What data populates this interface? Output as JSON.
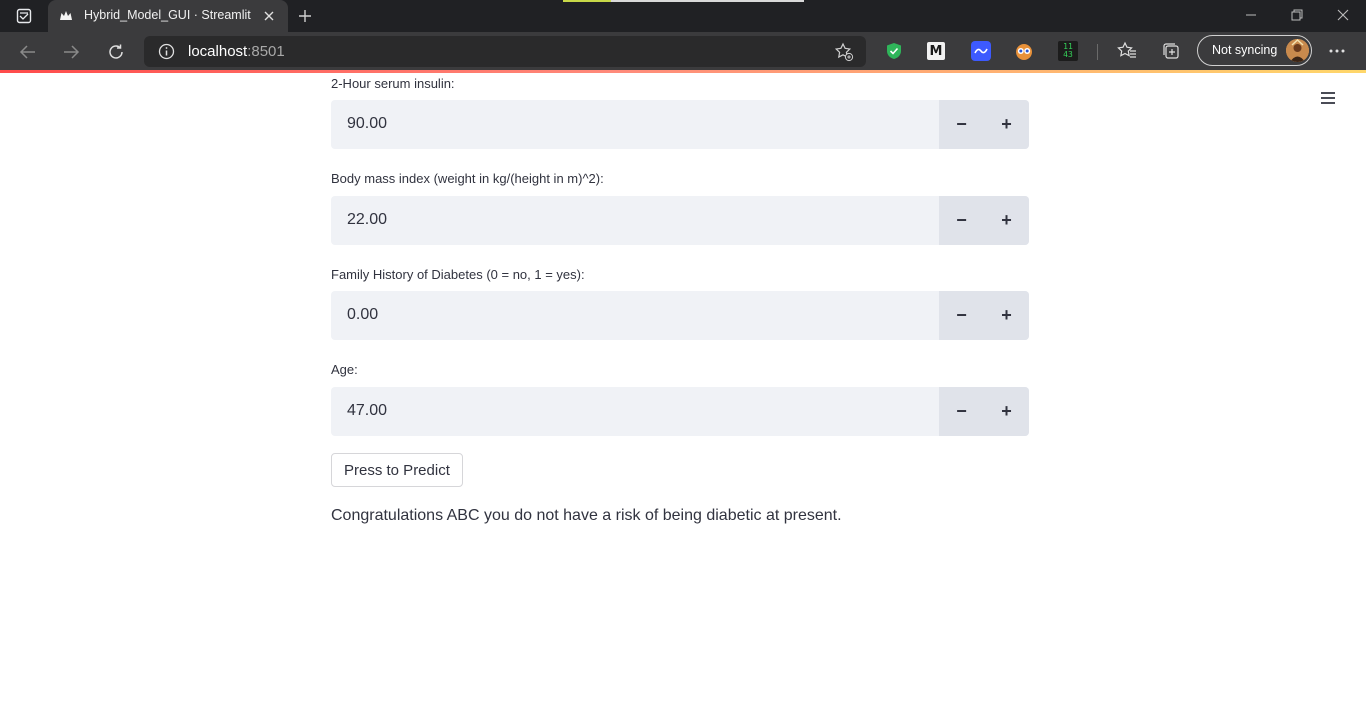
{
  "browser": {
    "tab_title": "Hybrid_Model_GUI · Streamlit",
    "url_host": "localhost",
    "url_port": ":8501",
    "sync_label": "Not syncing",
    "extension_badge": "11\n43",
    "icons": {
      "tab_actions": "tab-actions-icon",
      "favicon": "streamlit-crown-icon",
      "close": "close-icon",
      "new_tab": "plus-icon",
      "back": "back-arrow-icon",
      "forward": "forward-arrow-icon",
      "refresh": "refresh-icon",
      "info": "info-icon",
      "favorites_add": "star-plus-icon",
      "more": "ellipsis-icon"
    }
  },
  "app": {
    "menu_icon": "hamburger-menu-icon",
    "fields": [
      {
        "label": "2-Hour serum insulin:",
        "value": "90.00"
      },
      {
        "label": "Body mass index (weight in kg/(height in m)^2):",
        "value": "22.00"
      },
      {
        "label": "Family History of Diabetes (0 = no, 1 = yes):",
        "value": "0.00"
      },
      {
        "label": "Age:",
        "value": "47.00"
      }
    ],
    "step_minus": "−",
    "step_plus": "+",
    "predict_button": "Press to Predict",
    "result_text": "Congratulations ABC you do not have a risk of being diabetic at present."
  },
  "colors": {
    "chrome_dark": "#202124",
    "toolbar": "#3b3b3d",
    "input_bg": "#f0f2f6",
    "step_bg": "#e0e3ea",
    "text": "#31333f",
    "accent_gradient_start": "#ff4b4b"
  }
}
